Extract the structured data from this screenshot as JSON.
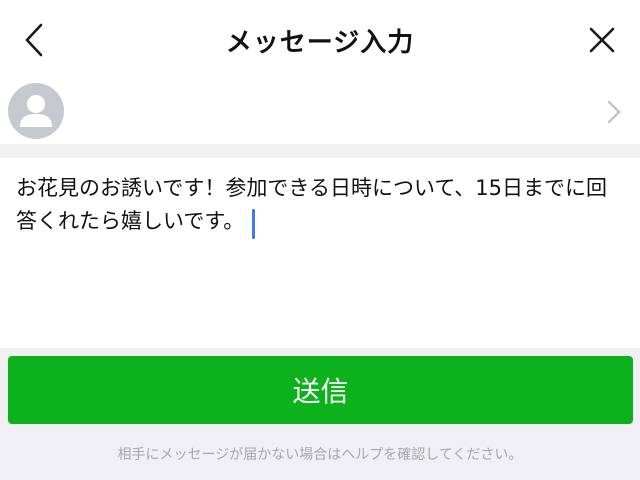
{
  "header": {
    "title": "メッセージ入力",
    "back_icon": "chevron-left-icon",
    "close_icon": "close-icon"
  },
  "recipient": {
    "avatar_icon": "default-avatar-icon",
    "chevron_icon": "chevron-right-icon"
  },
  "message": {
    "text": "お花見のお誘いです！参加できる日時について、15日までに回答くれたら嬉しいです。"
  },
  "actions": {
    "send_label": "送信"
  },
  "footer": {
    "note": "相手にメッセージが届かない場合はヘルプを確認してください。"
  },
  "colors": {
    "accent_green": "#0cb21c",
    "caret_blue": "#3d7bf5",
    "background": "#efeff4"
  }
}
